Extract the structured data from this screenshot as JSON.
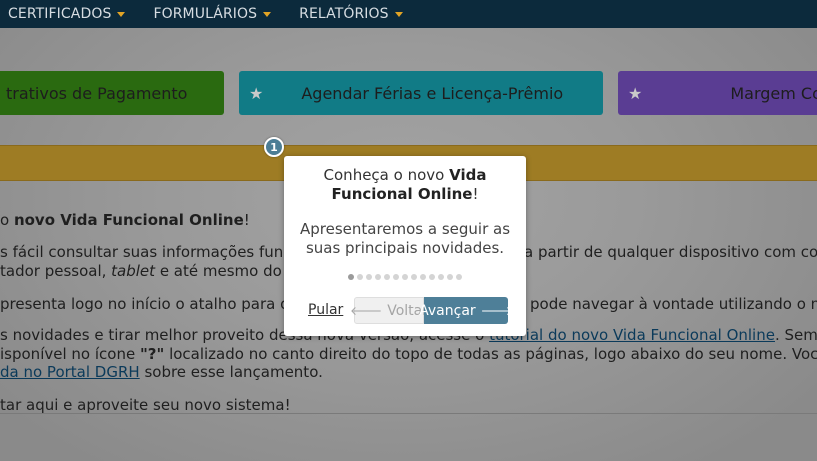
{
  "nav": {
    "items": [
      {
        "label": "CERTIFICADOS"
      },
      {
        "label": "FORMULÁRIOS"
      },
      {
        "label": "RELATÓRIOS"
      }
    ]
  },
  "tiles": [
    {
      "label": "trativos de Pagamento"
    },
    {
      "label": "Agendar Férias e Licença-Prêmio"
    },
    {
      "label": "Margem Co"
    }
  ],
  "content": {
    "line1_pre": "o ",
    "line1_bold": "novo Vida Funcional Online",
    "line1_post": "!",
    "line2_a": "s fácil consultar suas informações func",
    "line2_b": "a partir de qualquer dispositivo com con",
    "line3_a": "tador pessoal, ",
    "line3_italic": "tablet",
    "line3_b": " e até mesmo do se",
    "line4_a": "presenta logo no início o atalho para o c",
    "line4_b": "ê pode navegar à vontade utilizando o m",
    "line5_a": "s novidades e tirar melhor proveito dess",
    "line5_hidden": "a nova versão, acesse o ",
    "line5_link": "tutorial do novo Vida Funcional Online",
    "line5_b": ". Sempre q",
    "line6_a": "isponível no ícone ",
    "line6_bold": "\"?\"",
    "line6_b": " localizado no canto direito do topo de todas as páginas, logo abaixo do seu nome. Você ta",
    "line7_link": "da no Portal DGRH",
    "line7_b": " sobre esse lançamento.",
    "line8": "tar aqui e aproveite seu novo sistema!"
  },
  "tour": {
    "step_number": "1",
    "title_pre": "Conheça o novo ",
    "title_bold": "Vida Funcional Online",
    "title_post": "!",
    "body": "Apresentaremos a seguir as suas principais novidades.",
    "total_steps": 13,
    "current_step": 1,
    "skip_label": "Pular",
    "back_label": "Voltar",
    "next_label": "Avançar"
  },
  "colors": {
    "nav_bg": "#0c2a3c",
    "caret": "#e2a425",
    "tour_accent": "#4e7f98"
  }
}
